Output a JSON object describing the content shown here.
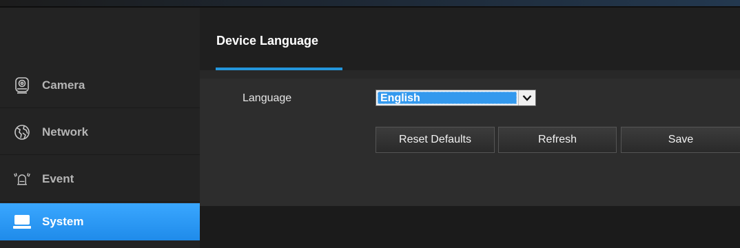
{
  "sidebar": {
    "items": [
      {
        "label": "Camera",
        "icon": "camera-icon"
      },
      {
        "label": "Network",
        "icon": "network-globe-icon"
      },
      {
        "label": "Event",
        "icon": "alarm-bell-icon"
      },
      {
        "label": "System",
        "icon": "monitor-icon",
        "active": true
      }
    ]
  },
  "header": {
    "title": "Device Language"
  },
  "form": {
    "language_label": "Language",
    "language_value": "English"
  },
  "buttons": {
    "reset": "Reset Defaults",
    "refresh": "Refresh",
    "save": "Save"
  },
  "colors": {
    "accent": "#2496dc",
    "selected_option": "#3399ee"
  }
}
